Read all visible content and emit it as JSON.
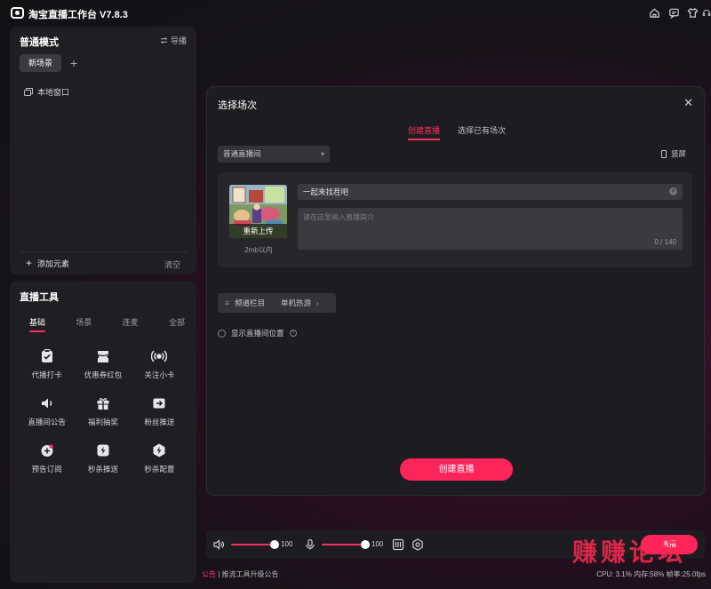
{
  "app": {
    "title": "淘宝直播工作台 V7.8.3"
  },
  "window_icons": [
    "home-icon",
    "chat-icon",
    "shirt-icon",
    "headset-icon",
    "minimize-icon",
    "maximize-icon",
    "close-icon"
  ],
  "scene_panel": {
    "title": "普通模式",
    "guide_label": "导播",
    "tab_label": "新场景",
    "source_item": "本地窗口",
    "add_element_label": "添加元素",
    "clear_label": "清空"
  },
  "tools_panel": {
    "title": "直播工具",
    "tabs": [
      "基础",
      "场景",
      "连麦",
      "全部"
    ],
    "tools": [
      {
        "label": "代播打卡",
        "icon": "clipboard-check-icon"
      },
      {
        "label": "优惠券红包",
        "icon": "coupon-icon"
      },
      {
        "label": "关注小卡",
        "icon": "broadcast-icon"
      },
      {
        "label": "直播间公告",
        "icon": "speaker-icon"
      },
      {
        "label": "福利抽奖",
        "icon": "gift-icon"
      },
      {
        "label": "粉丝推送",
        "icon": "forward-icon"
      },
      {
        "label": "预告订阅",
        "icon": "subscribe-icon"
      },
      {
        "label": "秒杀推送",
        "icon": "flash-push-icon"
      },
      {
        "label": "秒杀配置",
        "icon": "flash-config-icon"
      }
    ]
  },
  "modal": {
    "title": "选择场次",
    "tabs": [
      "创建直播",
      "选择已有场次"
    ],
    "room_type": "普通直播间",
    "portrait_label": "竖屏",
    "cover_reupload": "重新上传",
    "cover_size": "2mb以内",
    "live_title": "一起来找茬吧",
    "intro_placeholder": "请在这里输入直播简介",
    "intro_count": "0 / 140",
    "channel_label": "频道栏目",
    "channel_value": "单机热游",
    "location_label": "显示直播间位置",
    "create_button": "创建直播"
  },
  "audio_bar": {
    "speaker_volume": "100",
    "mic_volume": "100",
    "speaker_level": 1.0,
    "mic_level": 1.0,
    "live_button": "直播"
  },
  "footer": {
    "notice_tag": "公告",
    "notice_text": "推流工具升级公告",
    "stats": "CPU: 3.1% 内存:58% 帧率:25.0fps"
  },
  "watermark": "赚赚论坛",
  "colors": {
    "accent": "#ff2459",
    "panel": "#1f1f23",
    "modal": "#1d1d21"
  }
}
